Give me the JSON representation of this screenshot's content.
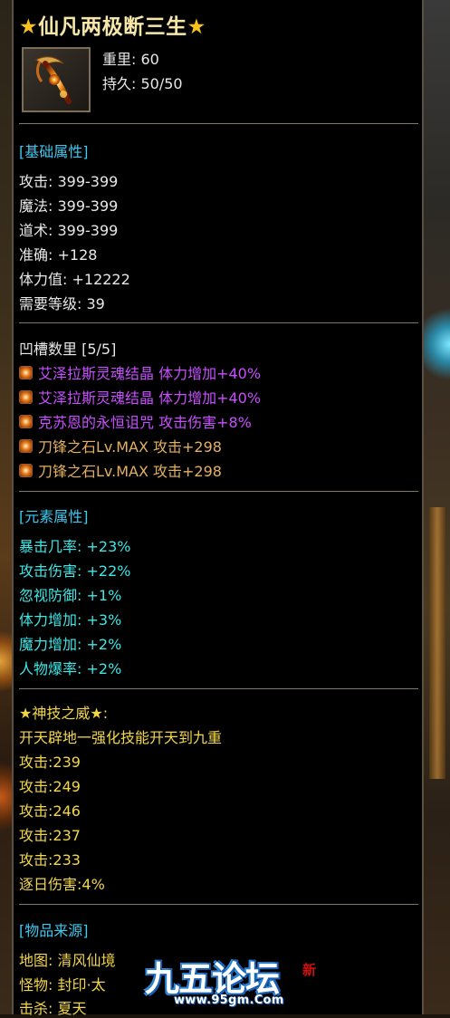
{
  "title": {
    "star_left": "★",
    "name": "仙凡两极断三生",
    "star_right": "★"
  },
  "item_icon": "scythe-weapon-icon",
  "basic_info": {
    "weight": "重里: 60",
    "durability": "持久: 50/50"
  },
  "base_attrs": {
    "header": "[基础属性]",
    "lines": [
      "攻击: 399-399",
      "魔法: 399-399",
      "道术: 399-399",
      "准确: +128",
      "体力值: +12222",
      "需要等级: 39"
    ]
  },
  "slots": {
    "header": "凹槽数里 [5/5]",
    "items": [
      {
        "text": "艾泽拉斯灵魂结晶 体力增加+40%",
        "color": "purple"
      },
      {
        "text": "艾泽拉斯灵魂结晶 体力增加+40%",
        "color": "purple"
      },
      {
        "text": "克苏恩的永恒诅咒 攻击伤害+8%",
        "color": "purple"
      },
      {
        "text": "刀锋之石Lv.MAX 攻击+298",
        "color": "gold"
      },
      {
        "text": "刀锋之石Lv.MAX 攻击+298",
        "color": "gold"
      }
    ]
  },
  "element_attrs": {
    "header": "[元素属性]",
    "lines": [
      "暴击几率: +23%",
      "攻击伤害: +22%",
      "忽视防御: +1%",
      "体力增加: +3%",
      "魔力增加: +2%",
      "人物爆率: +2%"
    ]
  },
  "divine_skill": {
    "header": "★神技之威★:",
    "desc": "开天辟地一强化技能开天到九重",
    "lines": [
      "攻击:239",
      "攻击:249",
      "攻击:246",
      "攻击:237",
      "攻击:233",
      "逐日伤害:4%"
    ]
  },
  "source": {
    "header": "[物品来源]",
    "lines": [
      "地图: 清风仙境",
      "怪物: 封印·太",
      "击杀: 夏天"
    ]
  },
  "watermark": {
    "text": "九五论坛",
    "url": "www.95gm.Com",
    "badge": "新"
  },
  "colors": {
    "bg": "#000000",
    "header": "#3fc8f0",
    "purple": "#c84fff",
    "gold": "#e3b062",
    "element": "#3fe6e6",
    "skill": "#f3d64c"
  }
}
